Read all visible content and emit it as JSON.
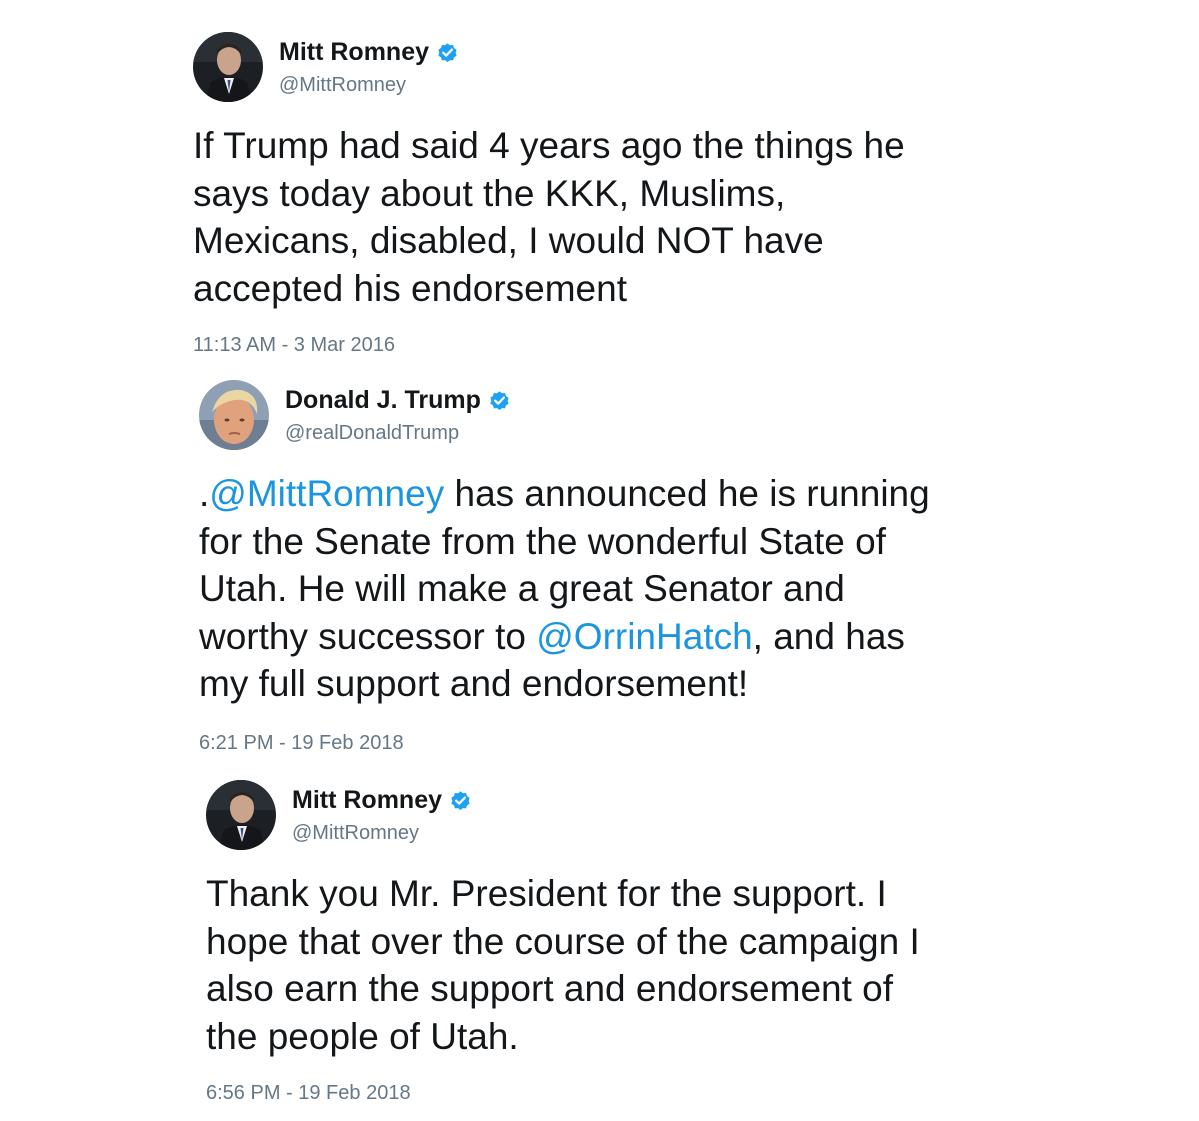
{
  "tweets": [
    {
      "display_name": "Mitt Romney",
      "handle": "@MittRomney",
      "verified": true,
      "avatar": "mitt-romney-avatar",
      "text_lines": [
        "If Trump had said 4 years ago the things he",
        "says today about the KKK, Muslims,",
        "Mexicans, disabled, I would NOT have",
        "accepted his endorsement"
      ],
      "timestamp": "11:13 AM - 3 Mar 2016"
    },
    {
      "display_name": "Donald J. Trump",
      "handle": "@realDonaldTrump",
      "verified": true,
      "avatar": "donald-trump-avatar",
      "text_parts": {
        "line1_prefix": ".",
        "line1_mention": "@MittRomney",
        "line1_rest": " has announced he is running",
        "line2": "for the Senate from the wonderful State of",
        "line3": "Utah. He will make a great Senator and",
        "line4_prefix": "worthy successor to ",
        "line4_mention": "@OrrinHatch",
        "line4_rest": ", and has",
        "line5": "my full support and endorsement!"
      },
      "timestamp": "6:21 PM - 19 Feb 2018"
    },
    {
      "display_name": "Mitt Romney",
      "handle": "@MittRomney",
      "verified": true,
      "avatar": "mitt-romney-avatar",
      "text_lines": [
        "Thank you Mr. President for the support. I",
        "hope that over the course of the campaign I",
        "also earn the support and endorsement of",
        "the people of Utah."
      ],
      "timestamp": "6:56 PM - 19 Feb 2018"
    }
  ],
  "colors": {
    "text": "#14171a",
    "secondary": "#657786",
    "link": "#1b95e0",
    "verified_badge": "#1da1f2"
  },
  "icons": {
    "verified": "verified-badge-icon"
  }
}
